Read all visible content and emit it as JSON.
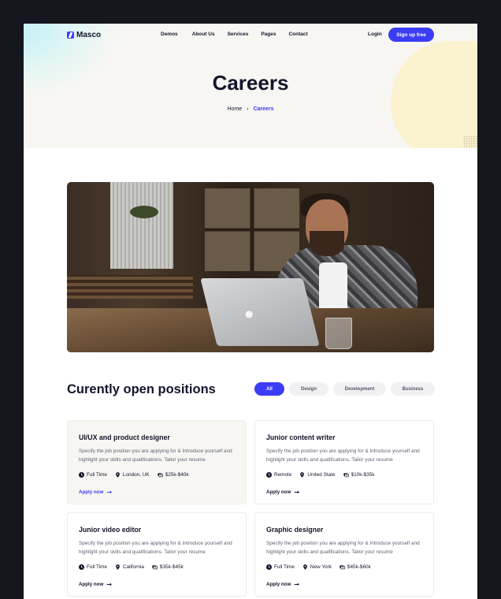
{
  "brand": {
    "name": "Masco",
    "accent": "#3b3df5"
  },
  "nav": {
    "items": [
      "Demos",
      "About Us",
      "Services",
      "Pages",
      "Contact"
    ],
    "login": "Login",
    "signup": "Sign up free"
  },
  "hero": {
    "title": "Careers",
    "breadcrumb": {
      "home": "Home",
      "separator": "›",
      "current": "Careers"
    }
  },
  "positions": {
    "title": "Curently open positions",
    "filters": [
      {
        "label": "All",
        "active": true
      },
      {
        "label": "Design",
        "active": false
      },
      {
        "label": "Development",
        "active": false
      },
      {
        "label": "Business",
        "active": false
      }
    ],
    "jobs": [
      {
        "title": "UI/UX and product designer",
        "desc": "Specify the job position you are applying for & Introduce yourself and highlight your skills and qualifications. Tailor your resume",
        "type": "Full Time",
        "location": "London, UK",
        "salary": "$25k-$40k",
        "apply": "Apply now",
        "highlight": true
      },
      {
        "title": "Junior content writer",
        "desc": "Specify the job position you are applying for & Introduce yourself and highlight your skills and qualifications. Tailor your resume",
        "type": "Remote",
        "location": "United State",
        "salary": "$10k-$35k",
        "apply": "Apply now",
        "highlight": false
      },
      {
        "title": "Junior video editor",
        "desc": "Specify the job position you are applying for & Introduce yourself and highlight your skills and qualifications. Tailor your resume",
        "type": "Full Time",
        "location": "California",
        "salary": "$35k-$45k",
        "apply": "Apply now",
        "highlight": false
      },
      {
        "title": "Graphic designer",
        "desc": "Specify the job position you are applying for & Introduce yourself and highlight your skills and qualifications. Tailor your resume",
        "type": "Full Time",
        "location": "New York",
        "salary": "$45k-$60k",
        "apply": "Apply now",
        "highlight": false
      }
    ]
  },
  "icons": {
    "clock": "clock-icon",
    "pin": "location-pin-icon",
    "money": "money-icon",
    "arrow": "arrow-right-icon"
  }
}
